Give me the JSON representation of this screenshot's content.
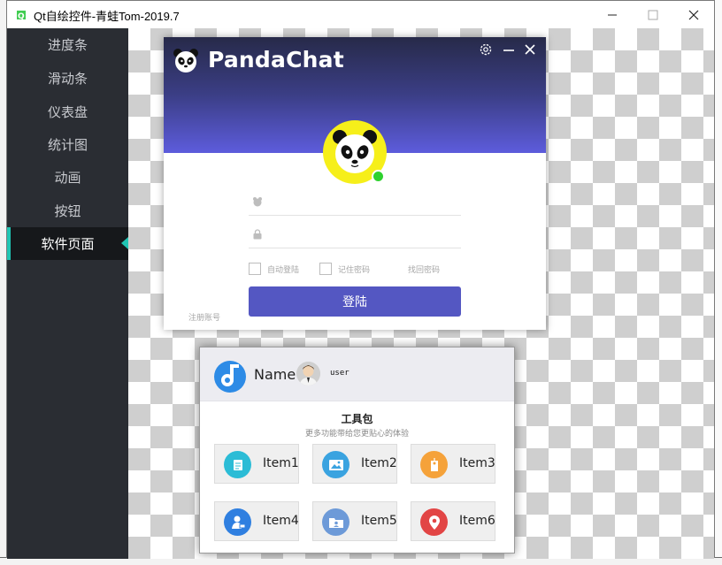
{
  "window": {
    "title": "Qt自绘控件-青蛙Tom-2019.7"
  },
  "sidebar": {
    "items": [
      {
        "label": "进度条"
      },
      {
        "label": "滑动条"
      },
      {
        "label": "仪表盘"
      },
      {
        "label": "统计图"
      },
      {
        "label": "动画"
      },
      {
        "label": "按钮"
      },
      {
        "label": "软件页面",
        "active": true
      }
    ],
    "accent_color": "#20c5b4"
  },
  "login": {
    "brand": "PandaChat",
    "username_icon": "bear-icon",
    "password_icon": "lock-icon",
    "auto_login_label": "自动登陆",
    "remember_label": "记住密码",
    "recover_label": "找回密码",
    "register_label": "注册账号",
    "login_button": "登陆",
    "online_status_color": "#2ed12e",
    "button_color": "#5457c2"
  },
  "toolbox": {
    "app_name": "Name",
    "user_name": "user",
    "title": "工具包",
    "subtitle": "更多功能带给您更贴心的体验",
    "items": [
      {
        "label": "Item1",
        "icon": "document-icon",
        "color": "#2bbcd6"
      },
      {
        "label": "Item2",
        "icon": "picture-icon",
        "color": "#3aa3e0"
      },
      {
        "label": "Item3",
        "icon": "tag-icon",
        "color": "#f5a23a"
      },
      {
        "label": "Item4",
        "icon": "user-cart-icon",
        "color": "#2f7fe0"
      },
      {
        "label": "Item5",
        "icon": "folder-user-icon",
        "color": "#6d9ad8"
      },
      {
        "label": "Item6",
        "icon": "location-pin-icon",
        "color": "#e24545"
      }
    ]
  }
}
